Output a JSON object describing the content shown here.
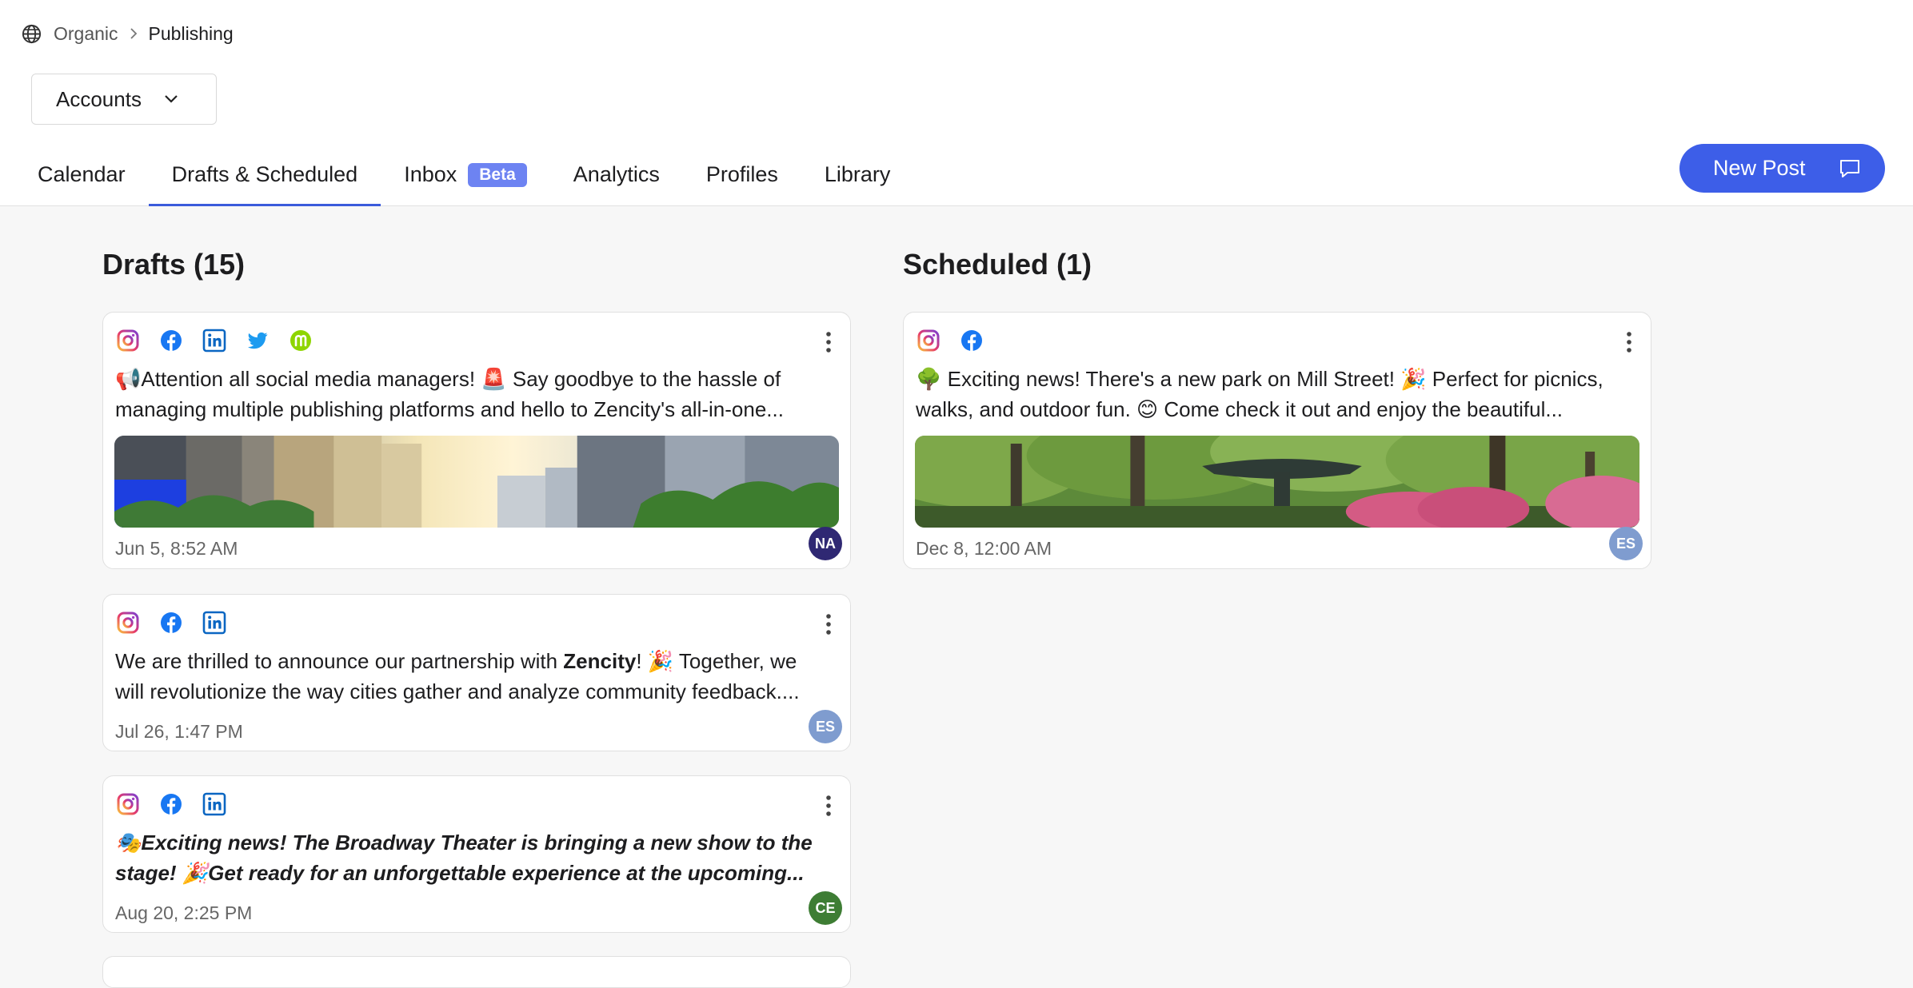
{
  "breadcrumb": {
    "root": "Organic",
    "current": "Publishing"
  },
  "accounts_button": {
    "label": "Accounts"
  },
  "tabs": [
    {
      "label": "Calendar"
    },
    {
      "label": "Drafts & Scheduled",
      "active": true
    },
    {
      "label": "Inbox",
      "badge": "Beta"
    },
    {
      "label": "Analytics"
    },
    {
      "label": "Profiles"
    },
    {
      "label": "Library"
    }
  ],
  "new_post_button": {
    "label": "New Post",
    "icon": "chat-bubble-icon"
  },
  "drafts": {
    "title": "Drafts (15)",
    "cards": [
      {
        "platforms": [
          "instagram",
          "facebook",
          "linkedin",
          "twitter",
          "nextdoor"
        ],
        "text": "📢Attention all social media managers! 🚨 Say goodbye to the hassle of managing multiple publishing platforms and hello to Zencity's all-in-one...",
        "image": "city-skyline",
        "date": "Jun 5, 8:52 AM",
        "author_initials": "NA",
        "author_color": "#2f2873"
      },
      {
        "platforms": [
          "instagram",
          "facebook",
          "linkedin"
        ],
        "text_before": "We are thrilled to announce our partnership with ",
        "text_bold": "Zencity",
        "text_after": "! 🎉 Together, we will revolutionize the way cities gather and analyze community feedback....",
        "date": "Jul 26, 1:47 PM",
        "author_initials": "ES",
        "author_color": "#7f9ccf"
      },
      {
        "platforms": [
          "instagram",
          "facebook",
          "linkedin"
        ],
        "text": "🎭Exciting news! The Broadway Theater is bringing a new show to the stage! 🎉Get ready for an unforgettable experience at the upcoming...",
        "date": "Aug 20, 2:25 PM",
        "author_initials": "CE",
        "author_color": "#3e7d34"
      }
    ]
  },
  "scheduled": {
    "title": "Scheduled (1)",
    "cards": [
      {
        "platforms": [
          "instagram",
          "facebook"
        ],
        "text": "🌳 Exciting news! There's a new park on Mill Street! 🎉 Perfect for picnics, walks, and outdoor fun. 😊 Come check it out and enjoy the beautiful...",
        "image": "park-fountain",
        "date": "Dec 8, 12:00 AM",
        "author_initials": "ES",
        "author_color": "#7f9ccf"
      }
    ]
  },
  "colors": {
    "accent": "#3d5ee8",
    "beta_badge": "#6d83f2",
    "active_tab_underline": "#3b5bdb"
  }
}
